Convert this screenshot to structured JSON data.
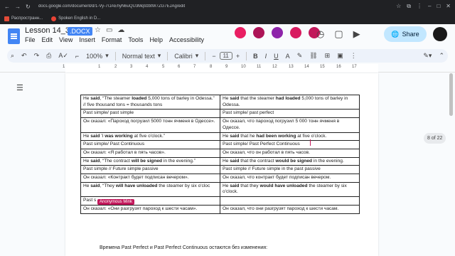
{
  "browser": {
    "url": "docs.google.com/document/d/1-Vy-7rJAEhyN6uQU3Mq9zbtW7ZG7EJAg/edit",
    "bookmarks": [
      "Распространн...",
      "Spoken English in D..."
    ]
  },
  "doc": {
    "title": "Lesson 14_3",
    "badge": ".DOCX",
    "menu": [
      "File",
      "Edit",
      "View",
      "Insert",
      "Format",
      "Tools",
      "Help",
      "Accessibility"
    ],
    "share_label": "Share"
  },
  "toolbar": {
    "zoom": "100%",
    "style": "Normal text",
    "font": "Calibri",
    "size": "11"
  },
  "ruler_marks": [
    "1",
    "1",
    "2",
    "3",
    "4",
    "5",
    "6",
    "7",
    "8",
    "9",
    "10",
    "11",
    "12",
    "13",
    "14",
    "15",
    "16",
    "17"
  ],
  "table": [
    {
      "l": [
        [
          "He ",
          ""
        ],
        [
          "said",
          "b"
        ],
        [
          ", “The steamer ",
          ""
        ],
        [
          "loaded",
          "b"
        ],
        [
          " 5,000 tons of barley in Odessa.” // five thousand tons = thousands tons",
          ""
        ]
      ],
      "r": [
        [
          "He ",
          ""
        ],
        [
          "said",
          "b"
        ],
        [
          " that the steamer ",
          ""
        ],
        [
          "had loaded",
          "b"
        ],
        [
          " 5,000 tons of barley in Odessa.",
          ""
        ]
      ]
    },
    {
      "l": [
        [
          "Past simple/ past simple",
          ""
        ]
      ],
      "r": [
        [
          "Past simple/ past perfect",
          ""
        ]
      ]
    },
    {
      "l": [
        [
          "Он сказал: «Пароход погрузил 5000 тонн ячменя в Одессе».",
          ""
        ]
      ],
      "r": [
        [
          "Он сказал, что пароход погрузил 5 000 тонн ячменя в Одессе.",
          ""
        ]
      ]
    },
    {
      "l": [
        [
          "He ",
          ""
        ],
        [
          "said",
          "b"
        ],
        [
          " 'I ",
          ""
        ],
        [
          "was working",
          "b"
        ],
        [
          " at five o'clock.”",
          ""
        ]
      ],
      "r": [
        [
          "He ",
          ""
        ],
        [
          "said",
          "b"
        ],
        [
          " that he ",
          ""
        ],
        [
          "had been working",
          "b"
        ],
        [
          " at five o'clock.",
          ""
        ]
      ]
    },
    {
      "l": [
        [
          "Past simple/ Past Continuous",
          ""
        ]
      ],
      "r": [
        [
          "Past simple/ Past Perfect Continuous",
          ""
        ]
      ]
    },
    {
      "l": [
        [
          "Он сказал: «Я работал в пять часов».",
          ""
        ]
      ],
      "r": [
        [
          "Он сказал, что он работал в пять часов.",
          ""
        ]
      ]
    },
    {
      "l": [
        [
          "He ",
          ""
        ],
        [
          "said",
          "b"
        ],
        [
          ", “The contract ",
          ""
        ],
        [
          "will be signed",
          "b"
        ],
        [
          " in the evening.”",
          ""
        ]
      ],
      "r": [
        [
          "He ",
          ""
        ],
        [
          "said",
          "b"
        ],
        [
          " that the contract ",
          ""
        ],
        [
          "would be signed",
          "b"
        ],
        [
          " in the evening.",
          ""
        ]
      ]
    },
    {
      "l": [
        [
          "Past simple // Future simple passive",
          ""
        ]
      ],
      "r": [
        [
          "Past simple // Future simple in the past passive",
          ""
        ]
      ]
    },
    {
      "l": [
        [
          "Он сказал: «Контракт будет подписан вечером».",
          ""
        ]
      ],
      "r": [
        [
          "Он сказал, что контракт будет подписан вечером.",
          ""
        ]
      ]
    },
    {
      "l": [
        [
          "He ",
          ""
        ],
        [
          "said",
          "b"
        ],
        [
          ", “They ",
          ""
        ],
        [
          "will have unloaded",
          "b"
        ],
        [
          " the steamer by six o'cloc",
          ""
        ]
      ],
      "r": [
        [
          "He ",
          ""
        ],
        [
          "said",
          "b"
        ],
        [
          " that they ",
          ""
        ],
        [
          "would have unloaded",
          "b"
        ],
        [
          " the steamer by six o'clock.",
          ""
        ]
      ]
    },
    {
      "l": [
        [
          "Past s",
          ""
        ]
      ],
      "r": [
        [
          "",
          ""
        ]
      ]
    },
    {
      "l": [
        [
          "Он сказал: «Они разгрузят пароход к шести часам».",
          ""
        ]
      ],
      "r": [
        [
          "Он сказал, что они разгрузят пароход к шести часам.",
          ""
        ]
      ]
    }
  ],
  "below_text": "Времена Past Perfect и Past Perfect Continuous остаются без изменения:",
  "page_counter": "8 of 22",
  "collaborator": "Anonymous Mink",
  "colors": {
    "accent": "#4285f4",
    "share": "#c2e7ff",
    "cursor": "#c2185b"
  }
}
